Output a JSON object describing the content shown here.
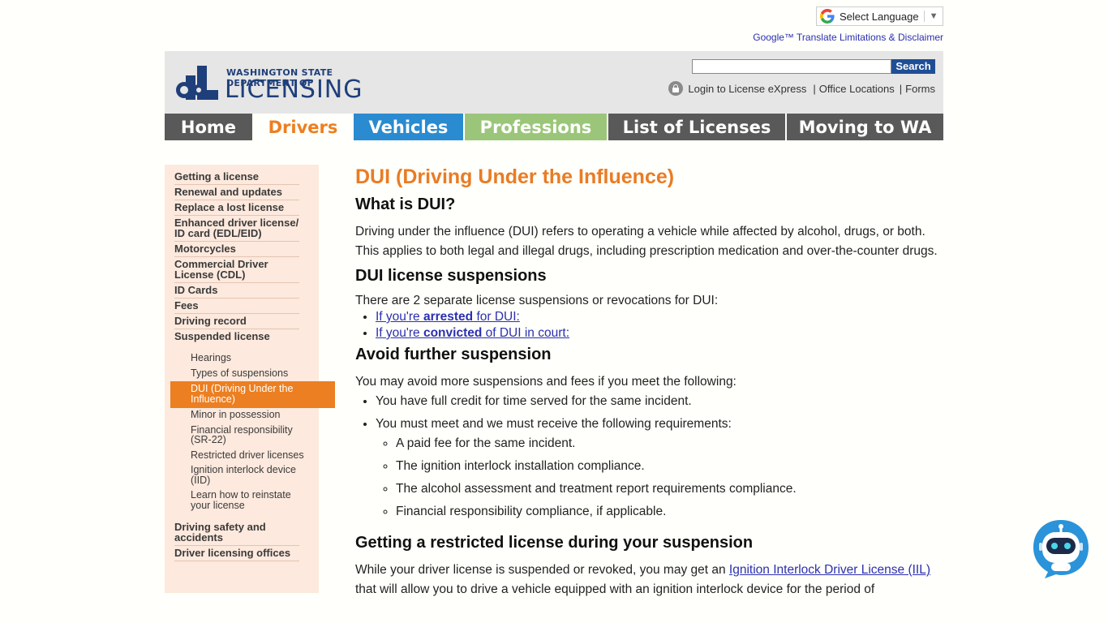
{
  "translate": {
    "label": "Select Language",
    "disclaimer": "Google™ Translate Limitations & Disclaimer"
  },
  "header": {
    "logo_small": "WASHINGTON STATE DEPARTMENT OF",
    "logo_big": "LICENSING",
    "search_placeholder": "",
    "search_button": "Search",
    "login_link": "Login to License eXpress",
    "pipe": "|",
    "office_link": "Office Locations",
    "forms_link": "Forms"
  },
  "nav": {
    "tabs": [
      {
        "label": "Home",
        "color": "#595959"
      },
      {
        "label": "Drivers",
        "color": "#fffffb",
        "text_color": "#ec7f21"
      },
      {
        "label": "Vehicles",
        "color": "#2a8bd0"
      },
      {
        "label": "Professions",
        "color": "#9bc67a"
      },
      {
        "label": "List of Licenses",
        "color": "#595959"
      },
      {
        "label": "Moving to WA",
        "color": "#595959"
      }
    ]
  },
  "sidebar": {
    "items": [
      {
        "label": "Getting a license"
      },
      {
        "label": "Renewal and updates"
      },
      {
        "label": "Replace a lost license"
      },
      {
        "label": "Enhanced driver license/ ID card (EDL/EID)"
      },
      {
        "label": "Motorcycles"
      },
      {
        "label": "Commercial Driver License (CDL)"
      },
      {
        "label": "ID Cards"
      },
      {
        "label": "Fees"
      },
      {
        "label": "Driving record"
      },
      {
        "label": "Suspended license"
      }
    ],
    "subitems": [
      {
        "label": "Hearings"
      },
      {
        "label": "Types of suspensions"
      },
      {
        "label": "DUI (Driving Under the Influence)",
        "active": true
      },
      {
        "label": "Minor in possession"
      },
      {
        "label": "Financial responsibility (SR-22)"
      },
      {
        "label": "Restricted driver licenses"
      },
      {
        "label": "Ignition interlock device (IID)"
      },
      {
        "label": "Learn how to reinstate your license"
      }
    ],
    "tail_items": [
      {
        "label": "Driving safety and accidents"
      },
      {
        "label": "Driver licensing offices"
      }
    ]
  },
  "content": {
    "title": "DUI (Driving Under the Influence)",
    "h_what": "What is DUI?",
    "p_what": "Driving under the influence (DUI) refers to operating a vehicle while affected by alcohol, drugs, or both. This applies to both legal and illegal drugs, including prescription medication and over-the-counter drugs.",
    "h_susp": "DUI license suspensions",
    "p_susp": "There are 2 separate license suspensions or revocations for DUI:",
    "link1_pre": "If you're ",
    "link1_bold": "arrested",
    "link1_post": " for DUI:",
    "link2_pre": "If you're ",
    "link2_bold": "convicted",
    "link2_post": " of DUI in court:",
    "h_avoid": "Avoid further suspension",
    "p_avoid": "You may avoid more suspensions and fees if you meet the following:",
    "avoid_items": [
      "You have full credit for time served for the same incident.",
      "You must meet and we must receive the following requirements:"
    ],
    "req_items": [
      "A paid fee for the same incident.",
      "The ignition interlock installation compliance.",
      "The alcohol assessment and treatment report requirements compliance.",
      "Financial responsibility compliance, if applicable."
    ],
    "h_restricted": "Getting a restricted license during your suspension",
    "p_restricted_pre": "While your driver license is suspended or revoked, you may get an ",
    "p_restricted_link": "Ignition Interlock Driver License (IIL)",
    "p_restricted_post": " that will allow you to drive a vehicle equipped with an ignition interlock device for the period of"
  },
  "chatbot": {
    "icon": "robot-icon"
  }
}
